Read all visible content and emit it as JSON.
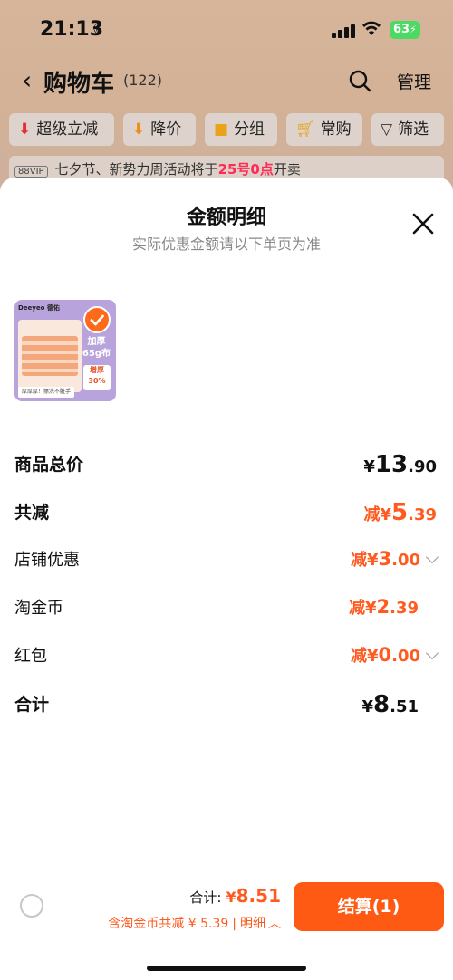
{
  "status_bar": {
    "time": "21:13",
    "battery": "63"
  },
  "nav": {
    "back": "‹",
    "title": "购物车",
    "count": "(122)",
    "manage": "管理"
  },
  "filters": [
    {
      "label": "超级立减",
      "icon": "arrow-down-icon",
      "color": "#e03030"
    },
    {
      "label": "降价",
      "icon": "price-drop-icon",
      "color": "#f08a18"
    },
    {
      "label": "分组",
      "icon": "folder-icon",
      "color": "#e8a317"
    },
    {
      "label": "常购",
      "icon": "cart-icon",
      "color": "#e8a317"
    },
    {
      "label": "筛选",
      "icon": "filter-icon",
      "color": "#333333"
    }
  ],
  "promo": {
    "badge": "88VIP",
    "text_before": "七夕节、新势力周活动将于",
    "highlight": "25号0点",
    "text_after": "开卖"
  },
  "sheet": {
    "title": "金额明细",
    "subtitle": "实际优惠金额请以下单页为准",
    "product": {
      "brand": "Deeyeo 德佑",
      "tag_main": "加厚\n65g布",
      "tag_sub": "增厚\n30%",
      "footer": "厚厚厚！擦洗不脏手"
    },
    "rows": [
      {
        "label": "商品总价",
        "prefix": "",
        "symbol": "¥",
        "int": "13",
        "dec": ".90",
        "style": "dark",
        "bold": true,
        "chevron": false
      },
      {
        "label": "共减",
        "prefix": "减",
        "symbol": "¥",
        "int": "5",
        "dec": ".39",
        "style": "orange",
        "bold": true,
        "chevron": false
      },
      {
        "label": "店铺优惠",
        "prefix": "减",
        "symbol": "¥",
        "int": "3",
        "dec": ".00",
        "style": "orange",
        "bold": false,
        "chevron": true
      },
      {
        "label": "淘金币",
        "prefix": "减",
        "symbol": "¥",
        "int": "2",
        "dec": ".39",
        "style": "orange",
        "bold": false,
        "chevron": false
      },
      {
        "label": "红包",
        "prefix": "减",
        "symbol": "¥",
        "int": "0",
        "dec": ".00",
        "style": "orange",
        "bold": false,
        "chevron": true
      },
      {
        "label": "合计",
        "prefix": "",
        "symbol": "¥",
        "int": "8",
        "dec": ".51",
        "style": "dark",
        "bold": true,
        "chevron": false
      }
    ]
  },
  "bottom": {
    "total_label": "合计:",
    "total_symbol": "¥",
    "total_value": "8.51",
    "discount_text": "含淘金币共减 ¥ 5.39",
    "detail_label": "明细",
    "checkout_label": "结算(1)"
  },
  "colors": {
    "accent": "#ff5a1f",
    "button": "#ff5a14"
  }
}
